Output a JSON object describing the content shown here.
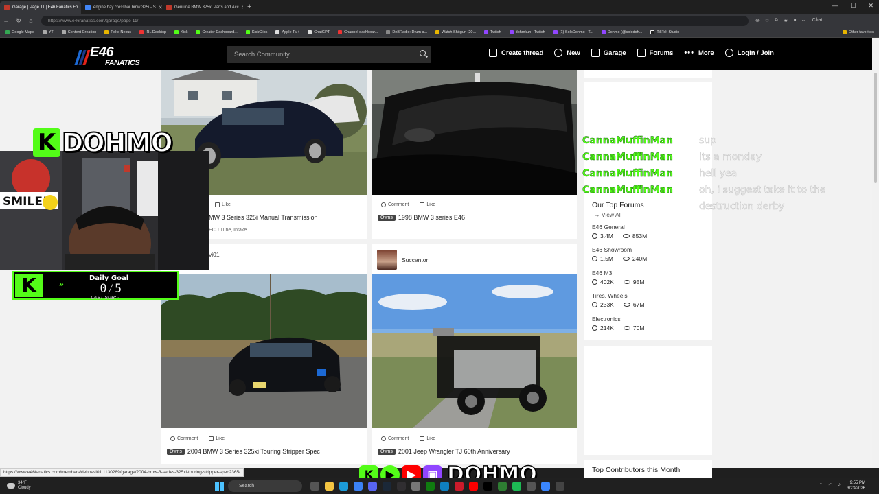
{
  "browser": {
    "tabs": [
      {
        "label": "Garage | Page 11 | E46 Fanatics Fo",
        "active": true,
        "color": "#c0392b"
      },
      {
        "label": "engine bay crossbar bmw 325i - S",
        "active": false,
        "color": "#4285f4"
      },
      {
        "label": "Genuine BMW 325xi Parts and Acc",
        "active": false,
        "color": "#c0392b"
      }
    ],
    "new_tab": "+",
    "url": "https://www.e46fanatics.com/garage/page-11/",
    "bookmarks": [
      "Google Maps",
      "YT",
      "Content Creation",
      "Poke Nexus",
      "IRL Desktop",
      "Kick",
      "Creator Dashboard...",
      "KickClips",
      "Apple TV+",
      "ChatGPT",
      "Channel dashboar...",
      "DnBRadio: Drum a...",
      "Watch Shōgun (20...",
      "Twitch",
      "dohmkun - Twitch",
      "(1) SoloDohmo - T...",
      "Dohmo (@solodoh...",
      "TikTok Studio"
    ],
    "other_favorites": "Other favorites",
    "chat_button": "Chat"
  },
  "site": {
    "logo": {
      "main": "E46",
      "sub": "FANATICS"
    },
    "search_placeholder": "Search Community",
    "nav": [
      {
        "label": "Create thread",
        "icon": "edit-icon"
      },
      {
        "label": "New",
        "icon": "new-icon"
      },
      {
        "label": "Garage",
        "icon": "garage-icon"
      },
      {
        "label": "Forums",
        "icon": "forums-icon"
      },
      {
        "label": "More",
        "icon": "more-icon"
      },
      {
        "label": "Login / Join",
        "icon": "user-icon"
      }
    ]
  },
  "cards": [
    {
      "actions": [
        "Like"
      ],
      "title": "MW 3 Series 325i Manual Transmission",
      "subtitle": "ECU Tune, Intake",
      "owns": ""
    },
    {
      "actions": [
        "Comment",
        "Like"
      ],
      "title": "1998 BMW 3 series E46",
      "owns": "Owns"
    },
    {
      "author": "vi01",
      "actions": [
        "Comment",
        "Like"
      ],
      "title": "2004 BMW 3 Series 325xi Touring Stripper Spec",
      "owns": "Owns"
    },
    {
      "author": "Succentor",
      "actions": [
        "Comment",
        "Like"
      ],
      "title": "2001 Jeep Wrangler TJ 60th Anniversary",
      "owns": "Owns"
    }
  ],
  "sidebar": {
    "top_forums_title": "Our Top Forums",
    "view_all": "View All",
    "forums": [
      {
        "name": "E46 General",
        "posts": "3.4M",
        "views": "853M"
      },
      {
        "name": "E46 Showroom",
        "posts": "1.5M",
        "views": "240M"
      },
      {
        "name": "E46 M3",
        "posts": "402K",
        "views": "95M"
      },
      {
        "name": "Tires, Wheels",
        "posts": "233K",
        "views": "67M"
      },
      {
        "name": "Electronics",
        "posts": "214K",
        "views": "70M"
      }
    ],
    "top_contributors_title": "Top Contributors this Month"
  },
  "overlay": {
    "channel_name": "DOHMO",
    "k_letter": "K",
    "goal_label": "Daily Goal",
    "goal_count": "0/5",
    "goal_sub": "LAST SUB: -",
    "chat": [
      {
        "user": "CannaMuffinMan",
        "msg": "sup"
      },
      {
        "user": "CannaMuffinMan",
        "msg": "its a monday"
      },
      {
        "user": "CannaMuffinMan",
        "msg": "hell yea"
      },
      {
        "user": "CannaMuffinMan",
        "msg": "oh, i suggest take it to the"
      }
    ],
    "chat_continuation": "destruction derby",
    "kick_color": "#53fc18",
    "play_color": "#53fc18",
    "youtube_color": "#ff0000",
    "twitch_color": "#9146ff"
  },
  "status_url": "https://www.e46fanatics.com/members/dehnavi01.1130289/garage/2004-bmw-3-series-325xi-touring-stripper-spec2365/",
  "taskbar": {
    "weather_temp": "34°F",
    "weather_desc": "Cloudy",
    "search": "Search",
    "time": "9:55 PM",
    "date": "3/23/2026"
  }
}
